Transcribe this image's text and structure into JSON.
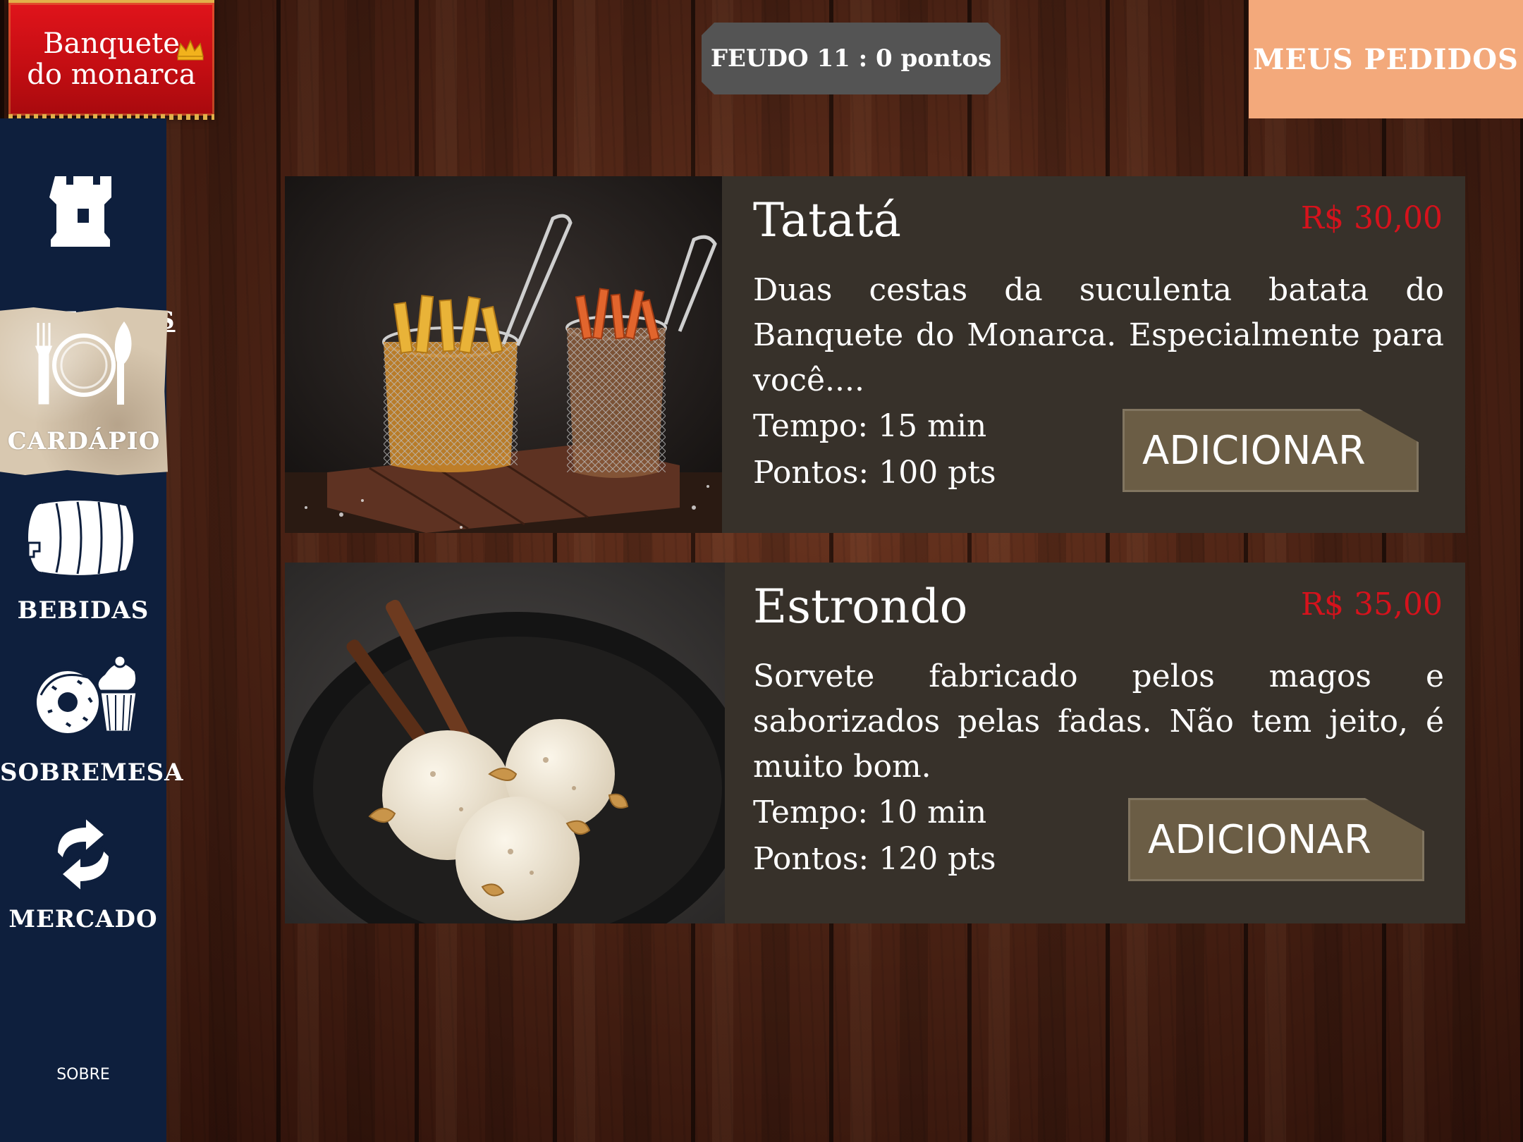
{
  "logo": {
    "line1": "Banquete",
    "line2": "do monarca"
  },
  "header": {
    "score": "FEUDO 11 : 0 pontos",
    "orders_label": "MEUS PEDIDOS"
  },
  "sidebar": {
    "items": [
      {
        "label": "DESTAQUES",
        "icon": "rook-icon",
        "active_underline": true
      },
      {
        "label": "CARDÁPIO",
        "icon": "plate-cutlery-icon",
        "selected": true
      },
      {
        "label": "BEBIDAS",
        "icon": "barrel-icon"
      },
      {
        "label": "SOBREMESA",
        "icon": "donut-cupcake-icon"
      },
      {
        "label": "MERCADO",
        "icon": "exchange-arrows-icon"
      }
    ],
    "sobre": "SOBRE"
  },
  "menu": {
    "items": [
      {
        "title": "Tatatá",
        "price": "R$ 30,00",
        "description": "Duas cestas da suculenta batata do Banquete do Monarca. Especialmente para você....",
        "time": "Tempo: 15 min",
        "points": "Pontos: 100 pts",
        "add_label": "ADICIONAR",
        "image": "fries-baskets-photo"
      },
      {
        "title": "Estrondo",
        "price": "R$ 35,00",
        "description": "Sorvete fabricado pelos magos e saborizados pelas fadas. Não tem jeito, é muito bom.",
        "time": "Tempo: 10 min",
        "points": "Pontos: 120 pts",
        "add_label": "ADICIONAR",
        "image": "ice-cream-bowl-photo"
      }
    ]
  },
  "colors": {
    "sidebar": "#0e1f3d",
    "logo_red": "#c20d12",
    "orders_button": "#f3a97b",
    "card_bg": "#37312a",
    "price_red": "#d6121c",
    "add_button": "#6b5d45",
    "score_badge": "#545454"
  }
}
